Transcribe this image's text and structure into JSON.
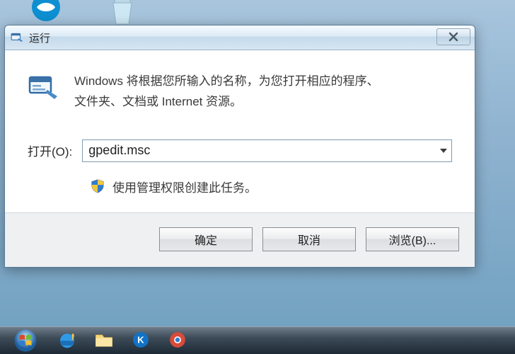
{
  "dialog": {
    "title": "运行",
    "description_line1": "Windows 将根据您所输入的名称，为您打开相应的程序、",
    "description_line2": "文件夹、文档或 Internet 资源。",
    "open_label": "打开(O):",
    "command_value": "gpedit.msc",
    "admin_note": "使用管理权限创建此任务。",
    "buttons": {
      "ok": "确定",
      "cancel": "取消",
      "browse": "浏览(B)..."
    }
  },
  "icons": {
    "run_small": "run-icon",
    "run_large": "run-icon",
    "close": "close-icon",
    "dropdown": "chevron-down-icon",
    "shield": "shield-icon",
    "start": "windows-start-icon",
    "ie": "internet-explorer-icon"
  }
}
